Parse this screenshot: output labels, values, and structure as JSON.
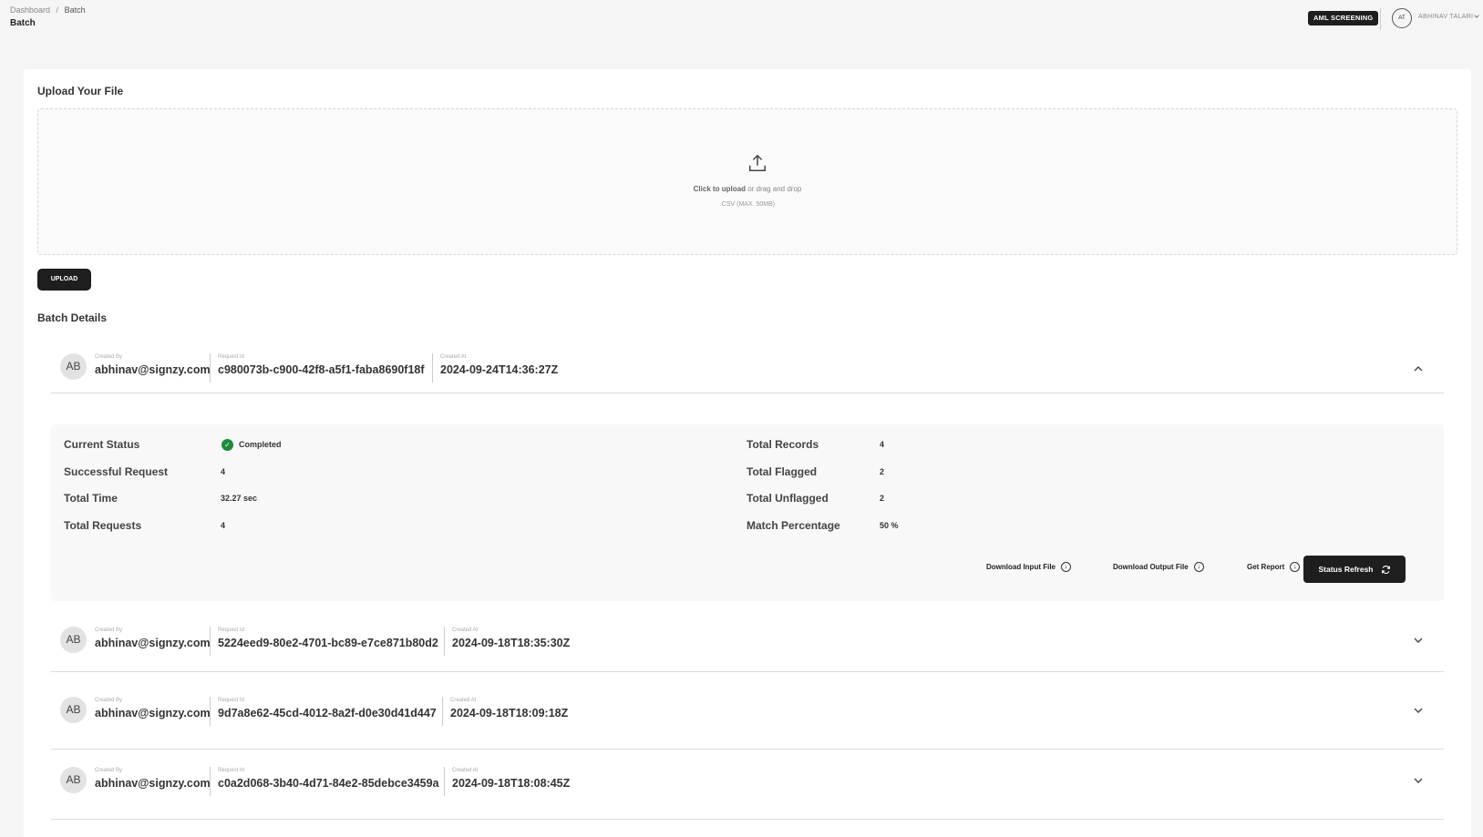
{
  "breadcrumb": {
    "items": [
      "Dashboard",
      "Batch"
    ],
    "separator": "/"
  },
  "page": {
    "title": "Batch"
  },
  "header": {
    "badge": "AML SCREENING",
    "avatar_initials": "AT",
    "username": "ABHINAV TALARI"
  },
  "upload": {
    "title": "Upload Your File",
    "click_text": "Click to upload",
    "drag_text": " or drag and drop",
    "hint": ".CSV (MAX. 50MB)",
    "button_label": "UPLOAD"
  },
  "batch": {
    "title": "Batch Details",
    "labels": {
      "created_by": "Created By",
      "request_id": "Request Id",
      "created_at": "Created At"
    },
    "rows": [
      {
        "initials": "AB",
        "created_by": "abhinav@signzy.com",
        "request_id": "c980073b-c900-42f8-a5f1-faba8690f18f",
        "created_at": "2024-09-24T14:36:27Z",
        "expanded": true
      },
      {
        "initials": "AB",
        "created_by": "abhinav@signzy.com",
        "request_id": "5224eed9-80e2-4701-bc89-e7ce871b80d2",
        "created_at": "2024-09-18T18:35:30Z",
        "expanded": false
      },
      {
        "initials": "AB",
        "created_by": "abhinav@signzy.com",
        "request_id": "9d7a8e62-45cd-4012-8a2f-d0e30d41d447",
        "created_at": "2024-09-18T18:09:18Z",
        "expanded": false
      },
      {
        "initials": "AB",
        "created_by": "abhinav@signzy.com",
        "request_id": "c0a2d068-3b40-4d71-84e2-85debce3459a",
        "created_at": "2024-09-18T18:08:45Z",
        "expanded": false
      }
    ],
    "details": {
      "current_status_label": "Current Status",
      "current_status": "Completed",
      "successful_request_label": "Successful Request",
      "successful_request": "4",
      "total_time_label": "Total Time",
      "total_time": "32.27 sec",
      "total_requests_label": "Total Requests",
      "total_requests": "4",
      "total_records_label": "Total Records",
      "total_records": "4",
      "total_flagged_label": "Total Flagged",
      "total_flagged": "2",
      "total_unflagged_label": "Total Unflagged",
      "total_unflagged": "2",
      "match_percentage_label": "Match Percentage",
      "match_percentage": "50 %"
    },
    "actions": {
      "download_input": "Download Input File",
      "download_output": "Download Output File",
      "get_report": "Get Report",
      "status_refresh": "Status Refresh"
    }
  },
  "colors": {
    "accent": "#1e1e1e",
    "success": "#1f8a3b",
    "background": "#f5f5f5"
  },
  "icons": [
    "upload-icon",
    "check-circle-icon",
    "download-icon",
    "refresh-icon",
    "chevron-up-icon",
    "chevron-down-icon"
  ]
}
